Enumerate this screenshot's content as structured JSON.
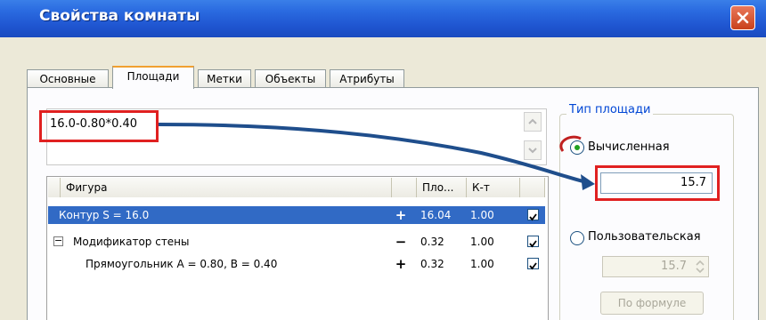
{
  "window": {
    "title": "Свойства комнаты"
  },
  "tabs": [
    {
      "label": "Основные"
    },
    {
      "label": "Площади"
    },
    {
      "label": "Метки"
    },
    {
      "label": "Объекты"
    },
    {
      "label": "Атрибуты"
    }
  ],
  "formula": {
    "value": "16.0-0.80*0.40"
  },
  "grid": {
    "columns": [
      "Фигура",
      "Пло...",
      "К-т"
    ],
    "rows": [
      {
        "figure": "Контур S = 16.0",
        "sign": "+",
        "area": "16.04",
        "k": "1.00",
        "checked": true
      },
      {
        "figure": "Модификатор стены",
        "sign": "−",
        "area": "0.32",
        "k": "1.00",
        "checked": true,
        "expander": "−"
      },
      {
        "figure": "Прямоугольник A = 0.80, B = 0.40",
        "sign": "+",
        "area": "0.32",
        "k": "1.00",
        "checked": true
      }
    ]
  },
  "area_type": {
    "title": "Тип площади",
    "calculated_label": "Вычисленная",
    "calculated_value": "15.7",
    "custom_label": "Пользовательская",
    "custom_value": "15.7",
    "formula_button": "По формуле"
  },
  "colors": {
    "callout": "#e02020",
    "arrow": "#1f4e8c",
    "selection": "#316ac5"
  }
}
